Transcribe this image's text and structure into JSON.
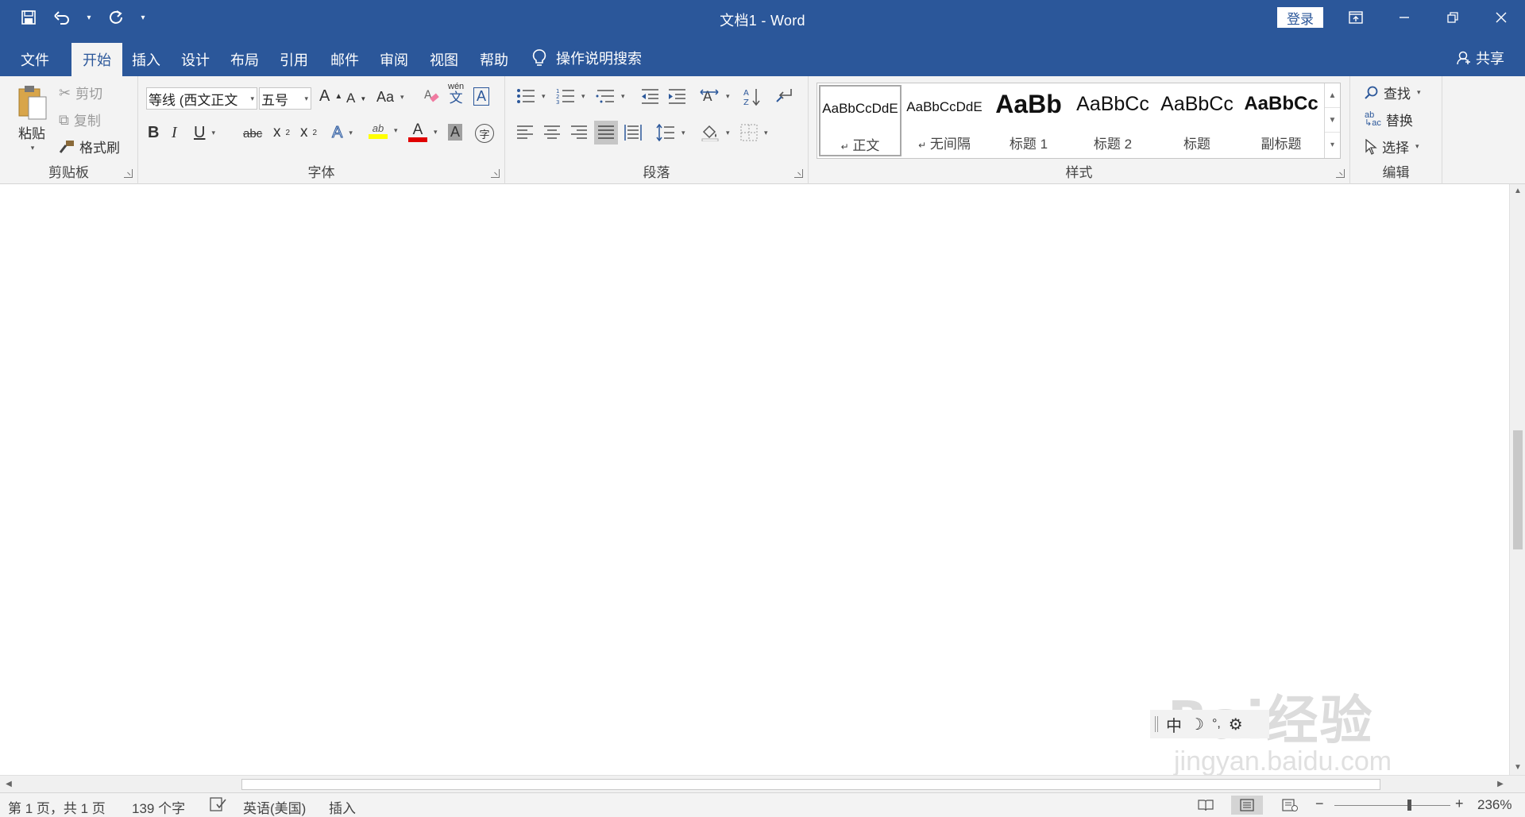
{
  "window": {
    "doc_name": "文档1",
    "separator": " - ",
    "app_name": "Word",
    "signin": "登录"
  },
  "qat": {
    "save_icon": "save-icon",
    "undo_icon": "undo-icon",
    "redo_icon": "repeat-icon",
    "customize_icon": "customize-icon"
  },
  "tabs": {
    "file": "文件",
    "home": "开始",
    "insert": "插入",
    "design": "设计",
    "layout": "布局",
    "references": "引用",
    "mailings": "邮件",
    "review": "审阅",
    "view": "视图",
    "help": "帮助"
  },
  "tellme": {
    "label": "操作说明搜索"
  },
  "share": {
    "label": "共享"
  },
  "clipboard": {
    "group": "剪贴板",
    "paste": "粘贴",
    "cut": "剪切",
    "copy": "复制",
    "format_painter": "格式刷"
  },
  "font": {
    "group": "字体",
    "font_name": "等线 (西文正文",
    "font_size": "五号",
    "grow": "A",
    "shrink": "A",
    "case": "Aa",
    "phonetic_top": "wén",
    "phonetic_bottom": "文",
    "char_border": "A",
    "bold": "B",
    "italic": "I",
    "underline": "U",
    "strike": "abc",
    "subscript": "x",
    "superscript": "x",
    "text_effects": "A",
    "highlight": "ab",
    "font_color": "A",
    "char_shading": "A",
    "enclose": "字"
  },
  "paragraph": {
    "group": "段落"
  },
  "styles": {
    "group": "样式",
    "items": [
      {
        "sample": "AaBbCcDdE",
        "name": "正文",
        "mark": "↵"
      },
      {
        "sample": "AaBbCcDdE",
        "name": "无间隔",
        "mark": "↵"
      },
      {
        "sample": "AaBb",
        "name": "标题 1",
        "mark": ""
      },
      {
        "sample": "AaBbCc",
        "name": "标题 2",
        "mark": ""
      },
      {
        "sample": "AaBbCc",
        "name": "标题",
        "mark": ""
      },
      {
        "sample": "AaBbCc",
        "name": "副标题",
        "mark": ""
      }
    ]
  },
  "editing": {
    "group": "编辑",
    "find": "查找",
    "replace": "替换",
    "select": "选择"
  },
  "ime": {
    "mode": "中"
  },
  "watermark": {
    "brand": "Bai经验",
    "url": "jingyan.baidu.com"
  },
  "status": {
    "page": "第 1 页，共 1 页",
    "words": "139 个字",
    "language": "英语(美国)",
    "mode": "插入",
    "zoom_minus": "−",
    "zoom_plus": "+",
    "zoom": "236%"
  },
  "colors": {
    "title_bar": "#2b579a",
    "ribbon": "#f3f3f3",
    "highlight_yellow": "#ffff00",
    "font_red": "#e00000"
  }
}
